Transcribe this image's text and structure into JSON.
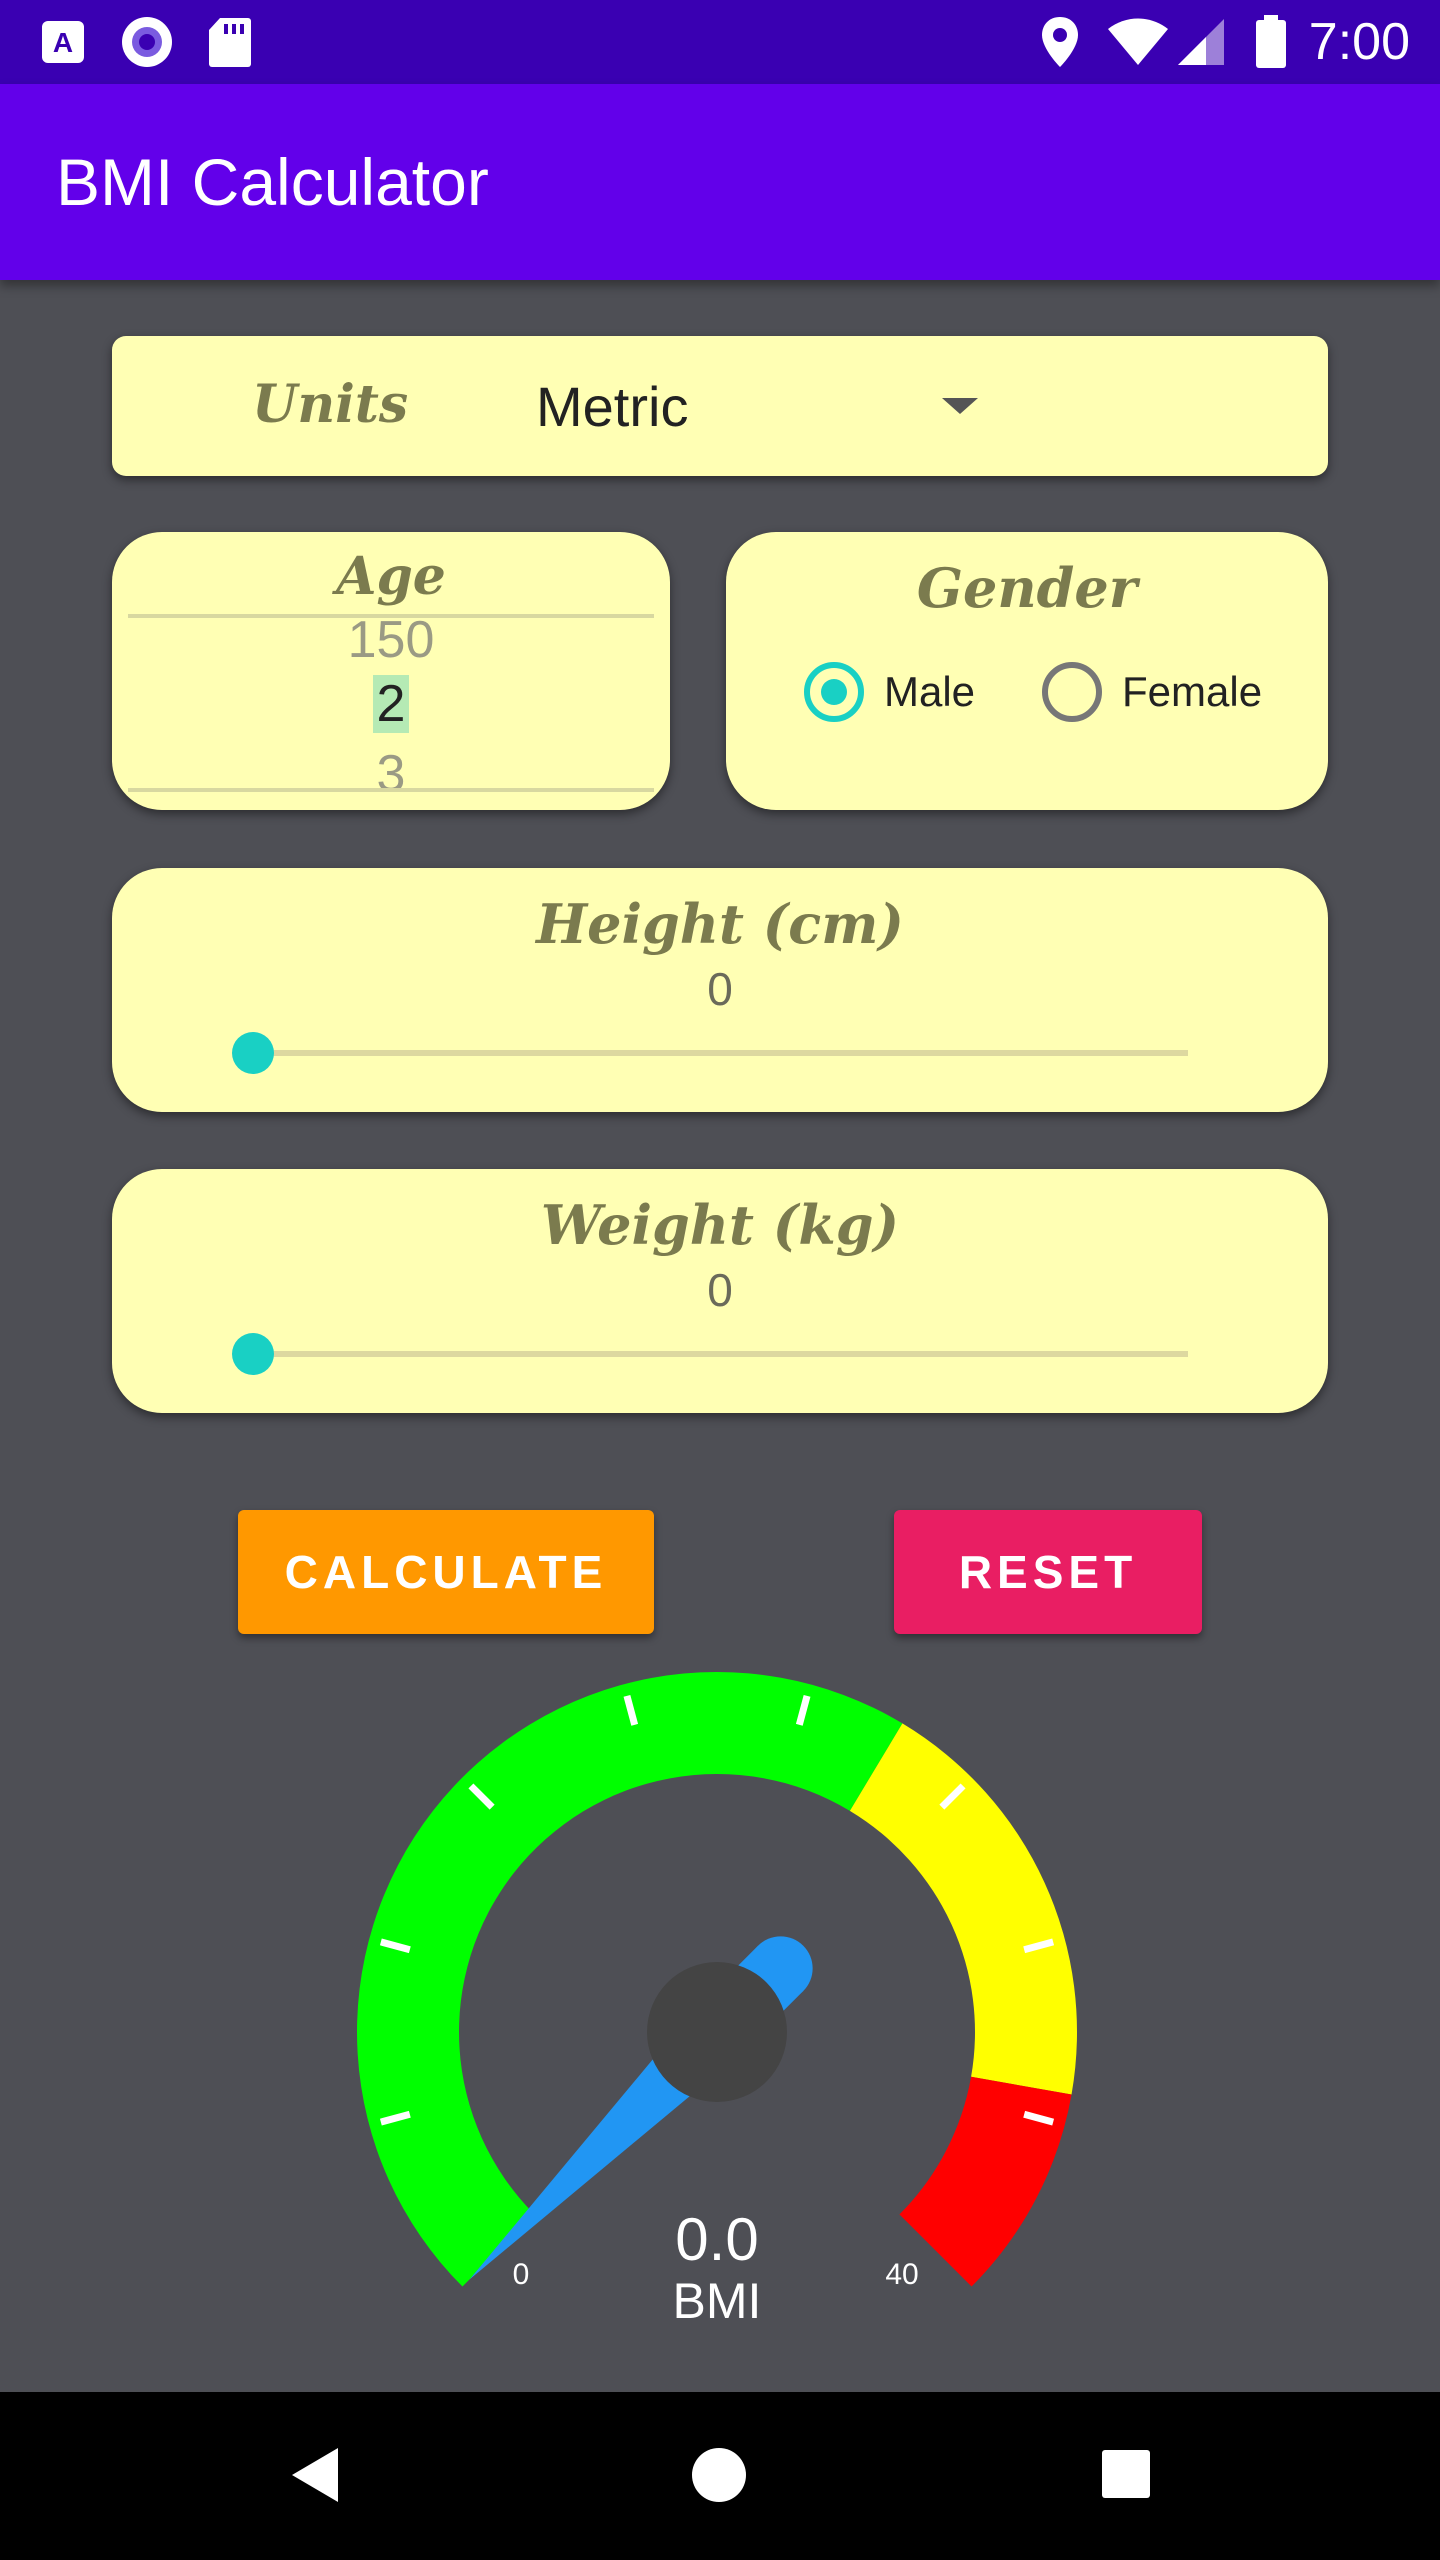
{
  "status_bar": {
    "time": "7:00",
    "left_icons": [
      "a-app-icon",
      "radio-circle-icon",
      "sd-card-icon"
    ],
    "right_icons": [
      "location-icon",
      "wifi-icon",
      "signal-icon",
      "battery-icon"
    ]
  },
  "app_bar": {
    "title": "BMI Calculator"
  },
  "units": {
    "label": "Units",
    "value": "Metric"
  },
  "age": {
    "label": "Age",
    "picker": {
      "above": "150",
      "selected": "2",
      "below": "3"
    }
  },
  "gender": {
    "label": "Gender",
    "options": [
      {
        "label": "Male",
        "selected": true
      },
      {
        "label": "Female",
        "selected": false
      }
    ]
  },
  "height": {
    "label": "Height (cm)",
    "value": "0"
  },
  "weight": {
    "label": "Weight (kg)",
    "value": "0"
  },
  "buttons": {
    "calculate": "CALCULATE",
    "reset": "RESET"
  },
  "gauge": {
    "value": "0.0",
    "unit": "BMI",
    "min_label": "0",
    "max_label": "40",
    "colors": {
      "normal": "#00ff00",
      "warning": "#ffff00",
      "danger": "#ff0000",
      "needle": "#2196f3",
      "hub": "#444444"
    }
  },
  "nav_bar": {
    "icons": [
      "back-icon",
      "home-icon",
      "recents-icon"
    ]
  }
}
